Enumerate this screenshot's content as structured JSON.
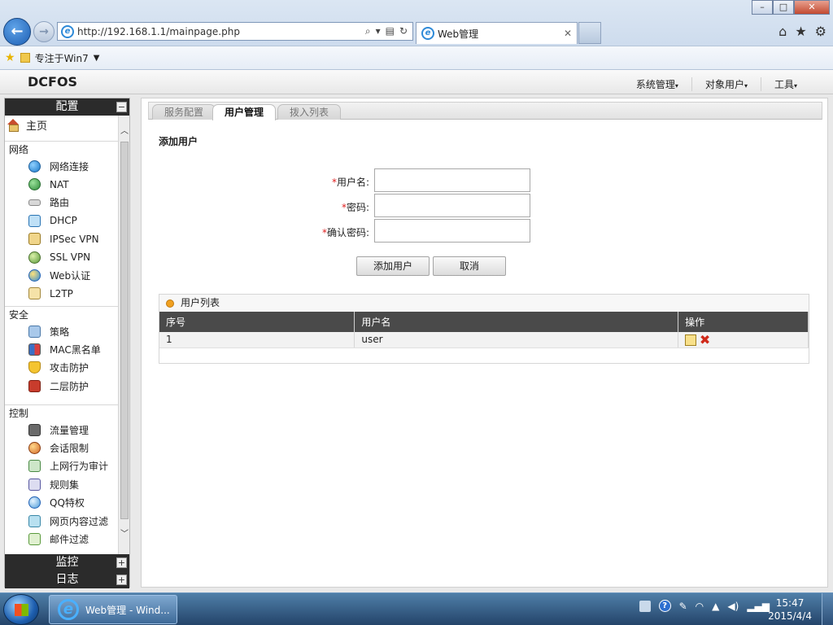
{
  "browser": {
    "url": "http://192.168.1.1/mainpage.php",
    "tab_title": "Web管理",
    "favorites_label": "专注于Win7"
  },
  "app": {
    "logo": "DCFOS",
    "top_menu": [
      "系统管理",
      "对象用户",
      "工具"
    ],
    "sidebar": {
      "config_title": "配置",
      "home_label": "主页",
      "sections": [
        {
          "title": "网络",
          "items": [
            "网络连接",
            "NAT",
            "路由",
            "DHCP",
            "IPSec VPN",
            "SSL VPN",
            "Web认证",
            "L2TP"
          ]
        },
        {
          "title": "安全",
          "items": [
            "策略",
            "MAC黑名单",
            "攻击防护",
            "二层防护"
          ]
        },
        {
          "title": "控制",
          "items": [
            "流量管理",
            "会话限制",
            "上网行为审计",
            "规则集",
            "QQ特权",
            "网页内容过滤",
            "邮件过滤"
          ]
        }
      ],
      "monitor_title": "监控",
      "log_title": "日志"
    },
    "tabs": [
      "服务配置",
      "用户管理",
      "拨入列表"
    ],
    "active_tab": "用户管理",
    "form": {
      "title": "添加用户",
      "username_label": "用户名:",
      "password_label": "密码:",
      "confirm_label": "确认密码:",
      "required_mark": "*",
      "username_value": "",
      "password_value": "",
      "confirm_value": "",
      "add_button": "添加用户",
      "cancel_button": "取消"
    },
    "user_list": {
      "title": "用户列表",
      "columns": [
        "序号",
        "用户名",
        "操作"
      ],
      "rows": [
        {
          "index": "1",
          "username": "user"
        }
      ]
    }
  },
  "taskbar": {
    "task_label": "Web管理 - Wind...",
    "time": "15:47",
    "date": "2015/4/4"
  }
}
